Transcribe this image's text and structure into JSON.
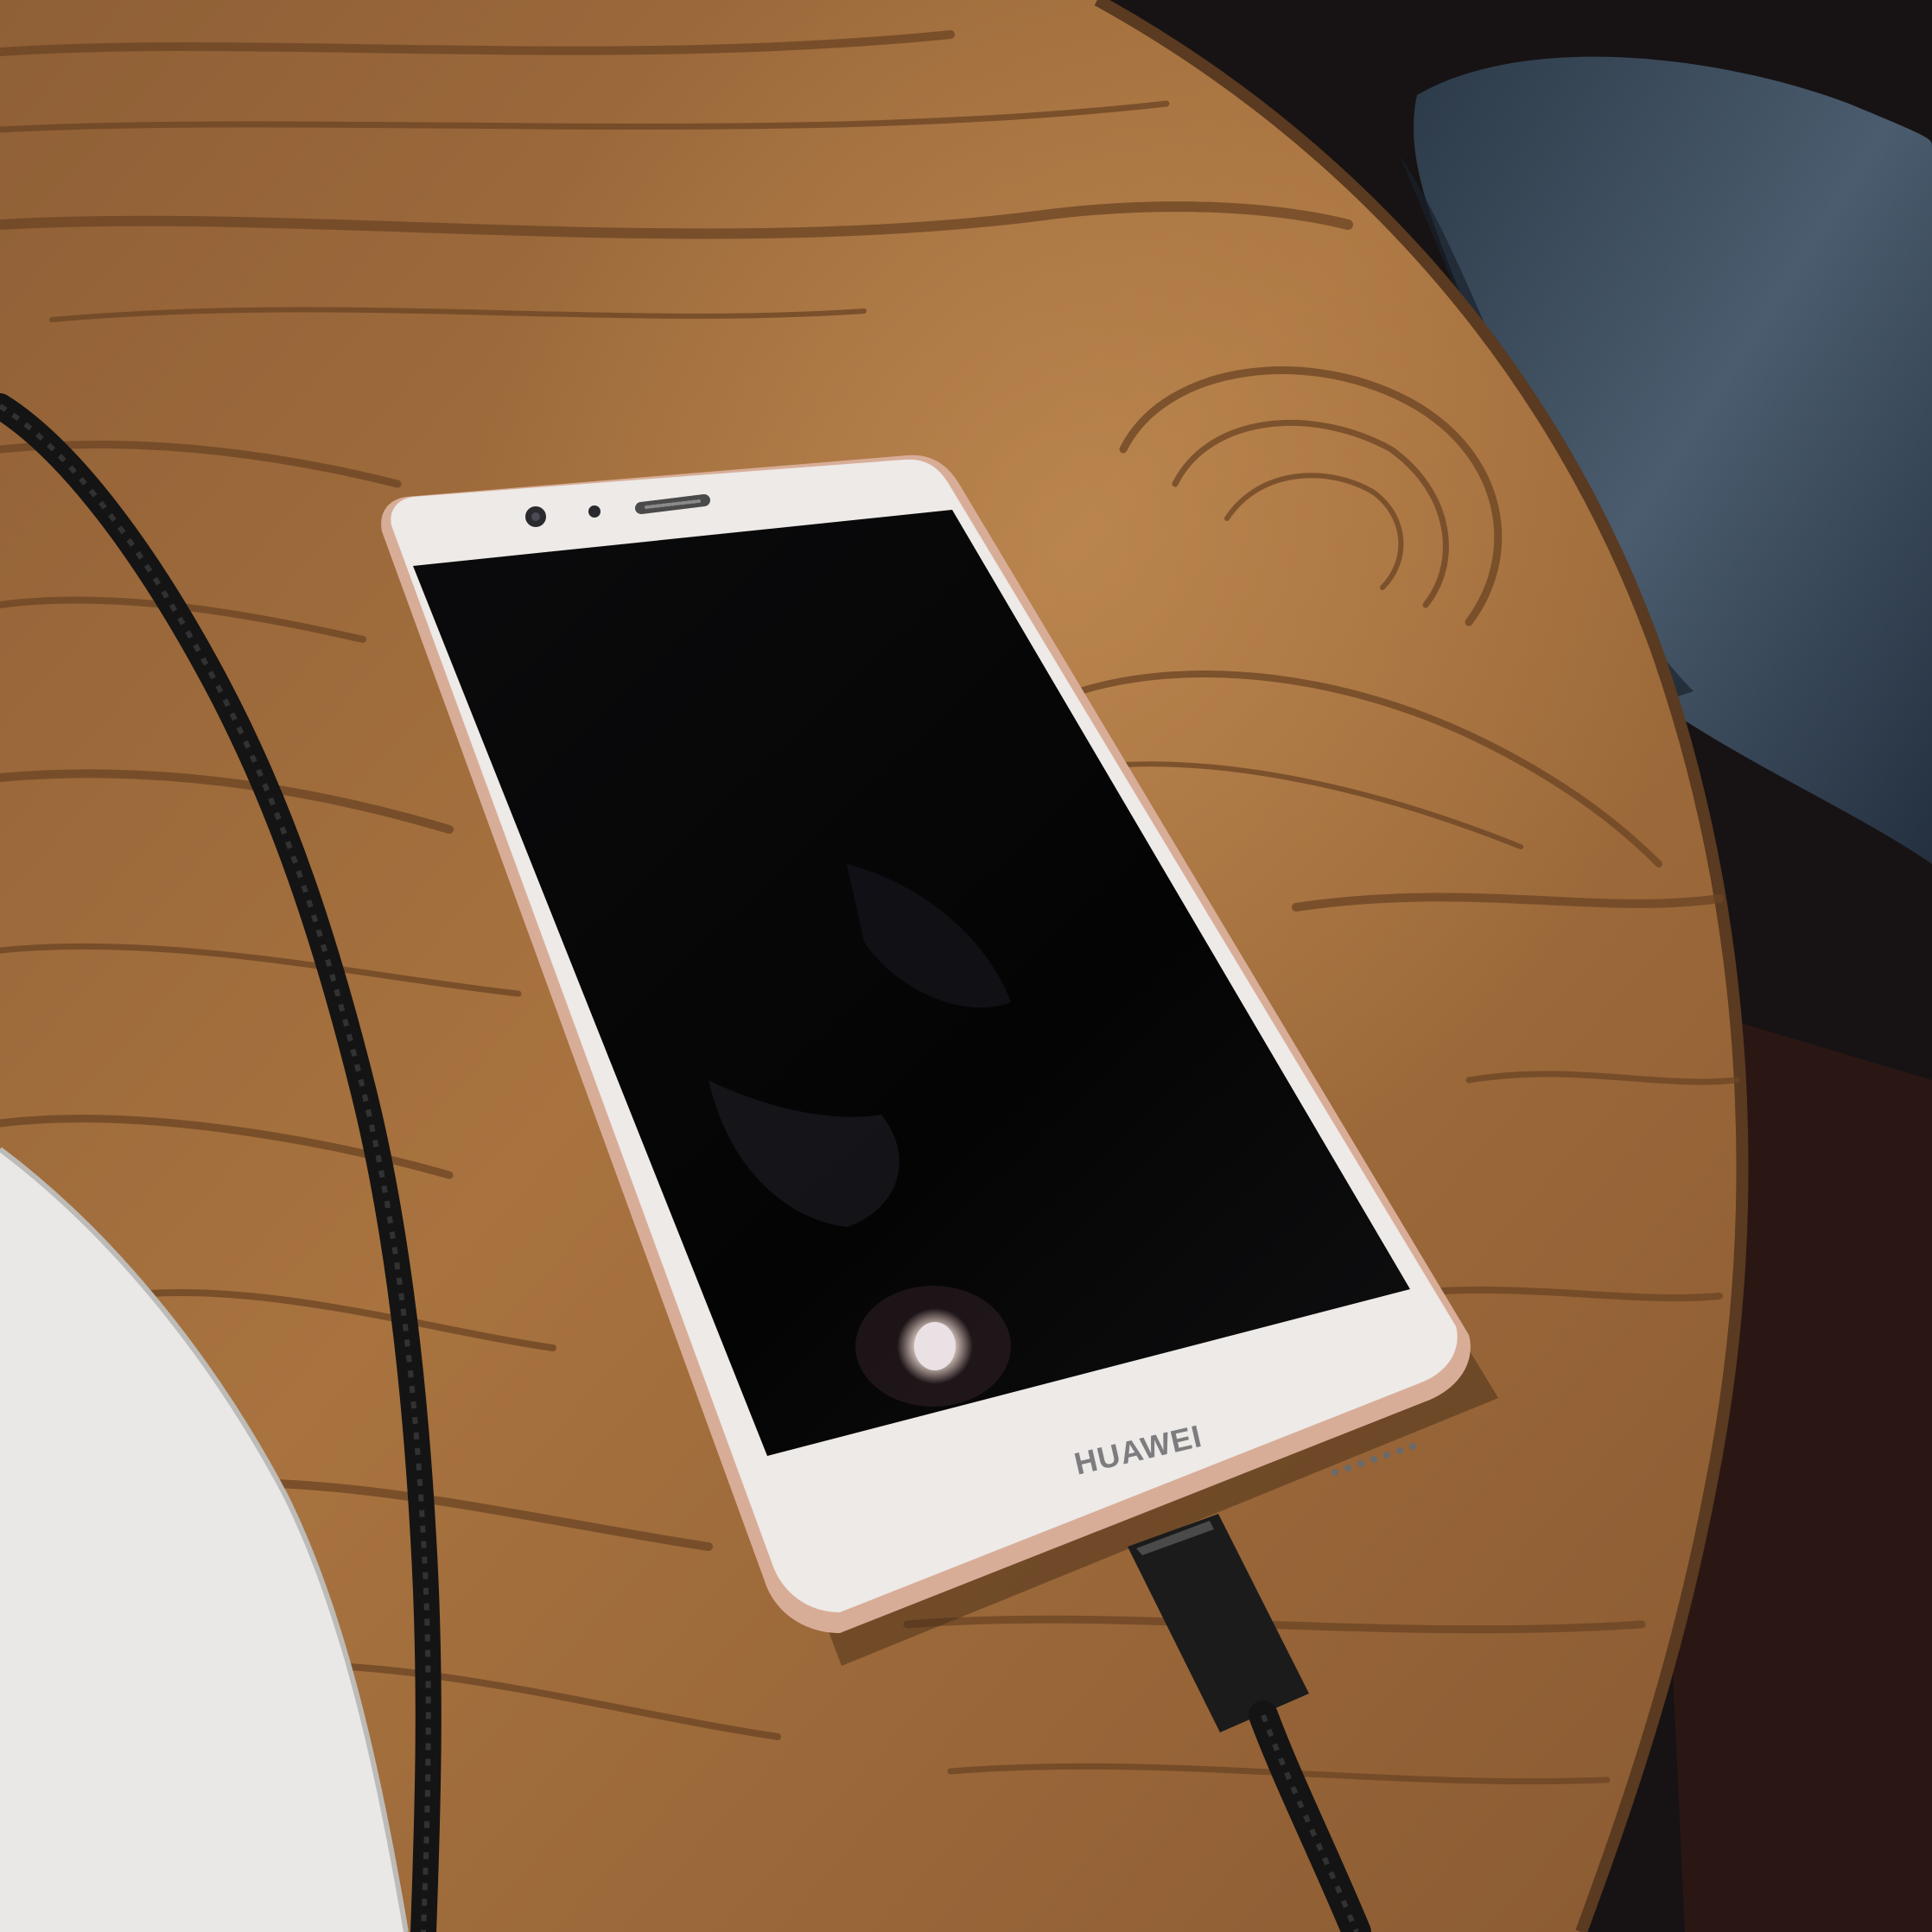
{
  "phone": {
    "brand": "HUAWEI"
  },
  "colors": {
    "wood_base": "#9a6a3e",
    "wood_dark": "#6e4626",
    "wood_light": "#b98450",
    "phone_white": "#ece9e6",
    "phone_edge": "#d2a995",
    "screen": "#050505",
    "cable": "#151515",
    "background_dark": "#161314",
    "jeans": "#3b4b5c",
    "paper": "#ebebeb"
  }
}
